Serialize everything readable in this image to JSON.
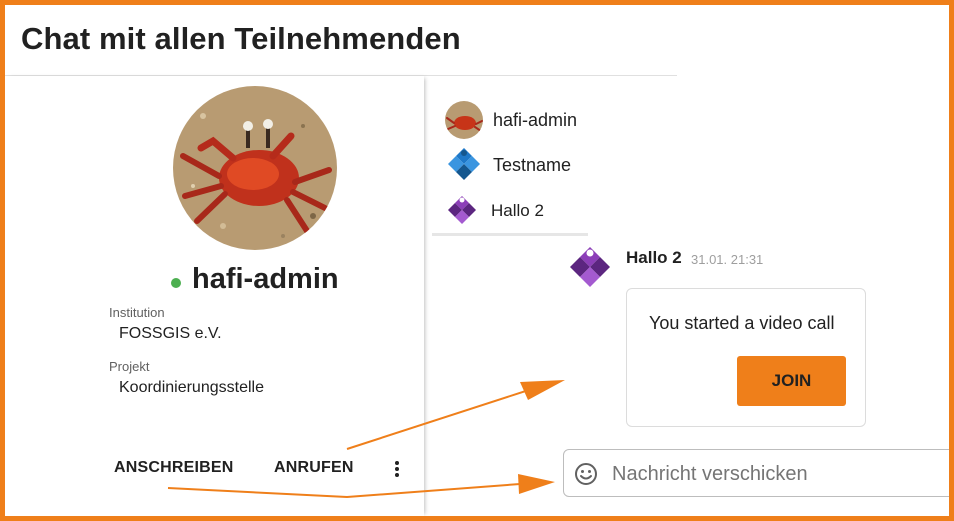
{
  "page": {
    "title": "Chat mit allen Teilnehmenden"
  },
  "profile": {
    "name": "hafi-admin",
    "status": "online",
    "institution_label": "Institution",
    "institution_value": "FOSSGIS e.V.",
    "projekt_label": "Projekt",
    "projekt_value": "Koordinierungsstelle",
    "actions": {
      "write": "ANSCHREIBEN",
      "call": "ANRUFEN"
    },
    "more_icon": "more-vert-icon"
  },
  "contacts": [
    {
      "name": "hafi-admin",
      "avatar": "crab-photo"
    },
    {
      "name": "Testname",
      "avatar": "blue-diamond-identicon"
    },
    {
      "name": "Hallo 2",
      "avatar": "purple-diamond-identicon"
    }
  ],
  "message": {
    "author": "Hallo 2",
    "time": "31.01. 21:31",
    "text": "You started a video call",
    "button": "JOIN"
  },
  "composer": {
    "placeholder": "Nachricht verschicken",
    "icon": "emoji-icon"
  },
  "colors": {
    "accent": "#ef7f1a",
    "online": "#4caf50",
    "identicon_blue": "#1e78c8",
    "identicon_purple": "#6a2c8e"
  }
}
